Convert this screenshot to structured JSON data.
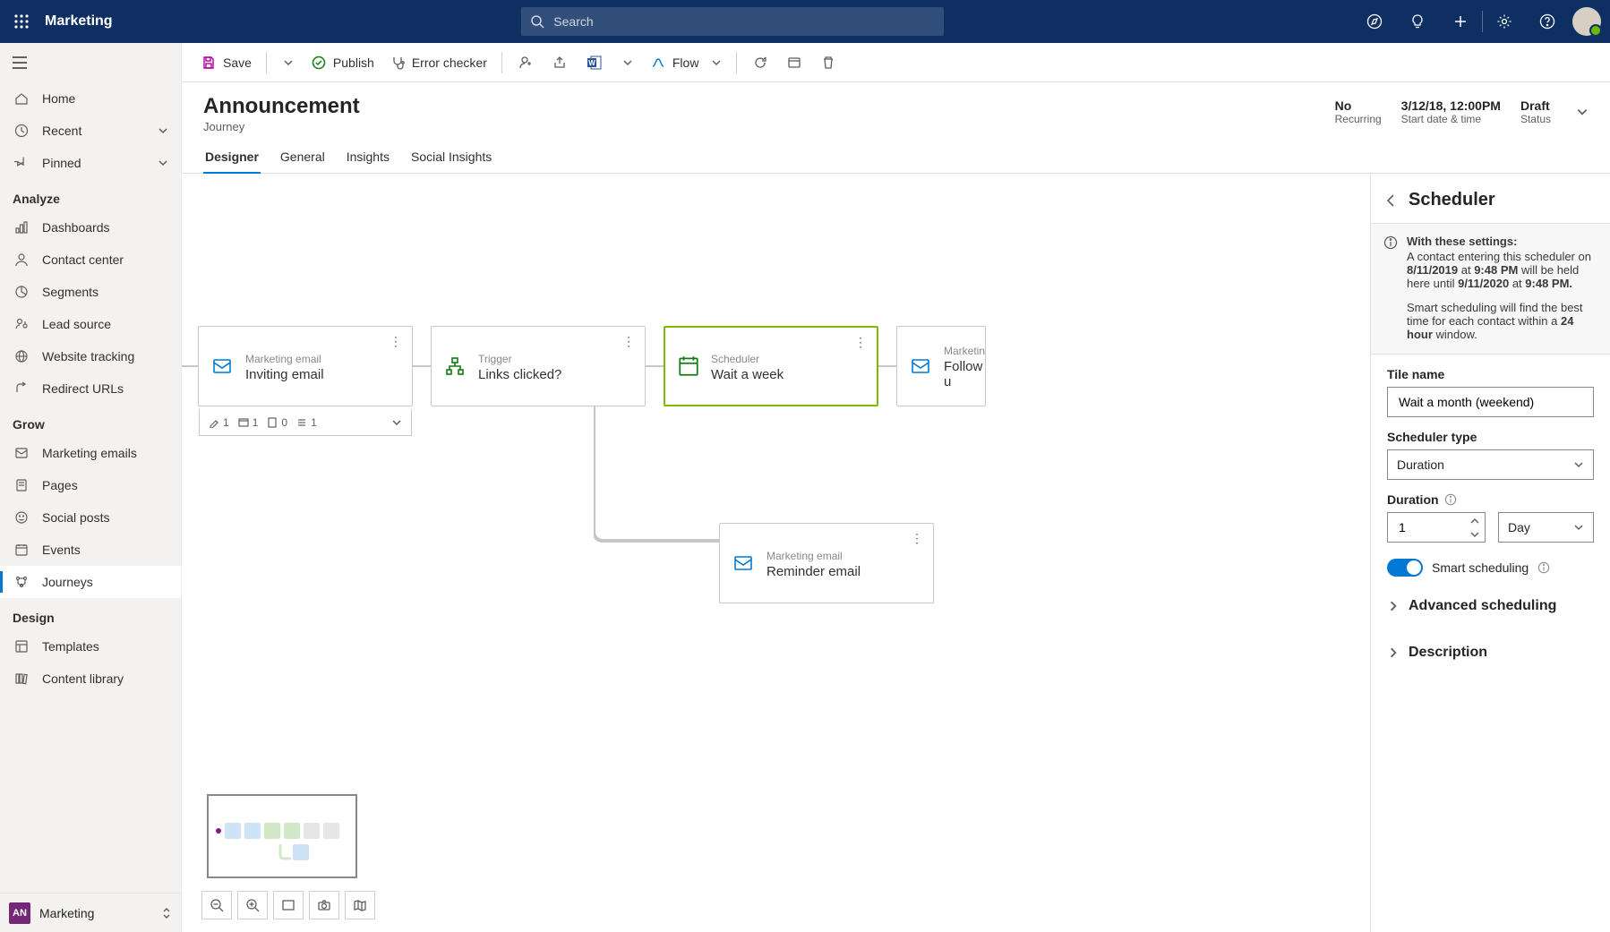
{
  "top": {
    "app": "Marketing",
    "search_placeholder": "Search"
  },
  "sidebar": {
    "top": [
      {
        "label": "Home"
      },
      {
        "label": "Recent",
        "expandable": true
      },
      {
        "label": "Pinned",
        "expandable": true
      }
    ],
    "groups": [
      {
        "title": "Analyze",
        "items": [
          {
            "label": "Dashboards"
          },
          {
            "label": "Contact center"
          },
          {
            "label": "Segments"
          },
          {
            "label": "Lead source"
          },
          {
            "label": "Website tracking"
          },
          {
            "label": "Redirect URLs"
          }
        ]
      },
      {
        "title": "Grow",
        "items": [
          {
            "label": "Marketing emails"
          },
          {
            "label": "Pages"
          },
          {
            "label": "Social posts"
          },
          {
            "label": "Events"
          },
          {
            "label": "Journeys",
            "selected": true
          }
        ]
      },
      {
        "title": "Design",
        "items": [
          {
            "label": "Templates"
          },
          {
            "label": "Content library"
          }
        ]
      }
    ],
    "footer": {
      "badge": "AN",
      "label": "Marketing"
    }
  },
  "commands": {
    "save": "Save",
    "publish": "Publish",
    "error_checker": "Error checker",
    "flow": "Flow"
  },
  "header": {
    "title": "Announcement",
    "subtitle": "Journey",
    "meta": [
      {
        "value": "No",
        "label": "Recurring"
      },
      {
        "value": "3/12/18, 12:00PM",
        "label": "Start date & time"
      },
      {
        "value": "Draft",
        "label": "Status"
      }
    ]
  },
  "tabs": [
    "Designer",
    "General",
    "Insights",
    "Social Insights"
  ],
  "tiles": {
    "email1": {
      "type": "Marketing email",
      "name": "Inviting email",
      "stats": [
        "1",
        "1",
        "0",
        "1"
      ]
    },
    "trigger": {
      "type": "Trigger",
      "name": "Links clicked?"
    },
    "scheduler": {
      "type": "Scheduler",
      "name": "Wait a week"
    },
    "email2": {
      "type": "Marketin",
      "name": "Follow u"
    },
    "reminder": {
      "type": "Marketing email",
      "name": "Reminder email"
    }
  },
  "panel": {
    "title": "Scheduler",
    "info_lead": "With these settings:",
    "info_1a": "A contact entering this scheduler on ",
    "info_date1": "8/11/2019",
    "info_at": " at ",
    "info_time1": "9:48 PM",
    "info_1b": " will be held here until ",
    "info_date2": "9/11/2020",
    "info_time2": "9:48 PM.",
    "info_2a": "Smart scheduling will find the best time for each contact within a ",
    "info_window": "24 hour",
    "info_2b": " window.",
    "tile_name_label": "Tile name",
    "tile_name_value": "Wait a month (weekend)",
    "scheduler_type_label": "Scheduler type",
    "scheduler_type_value": "Duration",
    "duration_label": "Duration",
    "duration_value": "1",
    "duration_unit": "Day",
    "smart_label": "Smart scheduling",
    "advanced": "Advanced scheduling",
    "description": "Description"
  }
}
